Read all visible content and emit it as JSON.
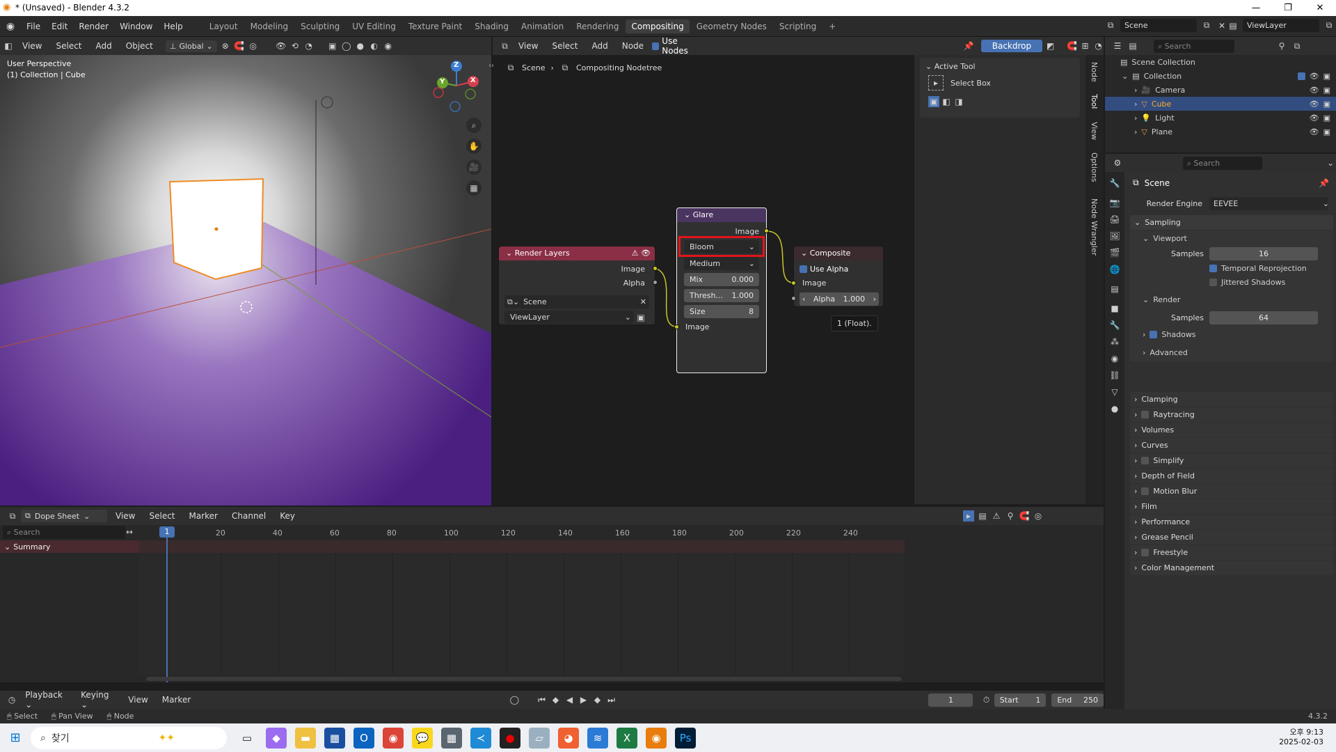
{
  "window": {
    "title": "* (Unsaved) - Blender 4.3.2"
  },
  "menubar": {
    "menus": [
      "File",
      "Edit",
      "Render",
      "Window",
      "Help"
    ],
    "workspaces": [
      "Layout",
      "Modeling",
      "Sculpting",
      "UV Editing",
      "Texture Paint",
      "Shading",
      "Animation",
      "Rendering",
      "Compositing",
      "Geometry Nodes",
      "Scripting"
    ],
    "active_workspace": "Compositing",
    "scene": "Scene",
    "view_layer": "ViewLayer"
  },
  "viewport": {
    "menus": [
      "View",
      "Select",
      "Add",
      "Object"
    ],
    "transform": "Global",
    "overlay_line1": "User Perspective",
    "overlay_line2": "(1) Collection | Cube",
    "gizmo": {
      "x": "X",
      "y": "Y",
      "z": "Z"
    },
    "floor_color": "#5b2a8f"
  },
  "node_editor": {
    "menus": [
      "View",
      "Select",
      "Add",
      "Node"
    ],
    "use_nodes_label": "Use Nodes",
    "backdrop_label": "Backdrop",
    "breadcrumb": [
      "Scene",
      "Compositing Nodetree"
    ],
    "render_layers": {
      "title": "Render Layers",
      "out_image": "Image",
      "out_alpha": "Alpha",
      "scene": "Scene",
      "view_layer": "ViewLayer"
    },
    "glare": {
      "title": "Glare",
      "out_image": "Image",
      "type": "Bloom",
      "quality": "Medium",
      "mix_label": "Mix",
      "mix_value": "0.000",
      "thresh_label": "Thresh...",
      "thresh_value": "1.000",
      "size_label": "Size",
      "size_value": "8",
      "in_image": "Image"
    },
    "composite": {
      "title": "Composite",
      "use_alpha": "Use Alpha",
      "in_image": "Image",
      "alpha_label": "Alpha",
      "alpha_value": "1.000"
    },
    "tooltip": "1 (Float).",
    "sidebar": {
      "title": "Active Tool",
      "tool": "Select Box"
    },
    "tabs": [
      "Node",
      "Tool",
      "View",
      "Options",
      "Node Wrangler"
    ]
  },
  "outliner": {
    "search_placeholder": "Search",
    "root": "Scene Collection",
    "collection": "Collection",
    "items": [
      {
        "name": "Camera",
        "icon": "camera-icon",
        "color": "#e39a4a"
      },
      {
        "name": "Cube",
        "icon": "mesh-icon",
        "color": "#e39a4a"
      },
      {
        "name": "Light",
        "icon": "light-icon",
        "color": "#e39a4a"
      },
      {
        "name": "Plane",
        "icon": "mesh-icon",
        "color": "#e39a4a"
      }
    ],
    "selected": "Cube"
  },
  "properties": {
    "search_placeholder": "Search",
    "scene": "Scene",
    "render_engine_label": "Render Engine",
    "render_engine": "EEVEE",
    "sampling": "Sampling",
    "viewport": "Viewport",
    "samples_label": "Samples",
    "viewport_samples": "16",
    "temporal_reprojection": "Temporal Reprojection",
    "jittered_shadows": "Jittered Shadows",
    "render": "Render",
    "render_samples": "64",
    "shadows": "Shadows",
    "advanced": "Advanced",
    "sections": [
      "Clamping",
      "Raytracing",
      "Volumes",
      "Curves",
      "Simplify",
      "Depth of Field",
      "Motion Blur",
      "Film",
      "Performance",
      "Grease Pencil",
      "Freestyle",
      "Color Management"
    ],
    "checkable_sections": [
      "Raytracing",
      "Simplify",
      "Motion Blur",
      "Freestyle"
    ]
  },
  "dopesheet": {
    "mode": "Dope Sheet",
    "menus": [
      "View",
      "Select",
      "Marker",
      "Channel",
      "Key"
    ],
    "search_placeholder": "Search",
    "summary": "Summary",
    "frame_marks": [
      "20",
      "40",
      "60",
      "80",
      "100",
      "120",
      "140",
      "160",
      "180",
      "200",
      "220",
      "240"
    ],
    "current_frame": "1"
  },
  "timeline": {
    "menus": [
      "Playback",
      "Keying",
      "View",
      "Marker"
    ],
    "frame": "1",
    "start_label": "Start",
    "start": "1",
    "end_label": "End",
    "end": "250"
  },
  "statusbar": {
    "items": [
      "Select",
      "Pan View",
      "Node"
    ],
    "version": "4.3.2"
  },
  "taskbar": {
    "search": "찾기",
    "time": "오후 9:13",
    "date": "2025-02-03"
  }
}
